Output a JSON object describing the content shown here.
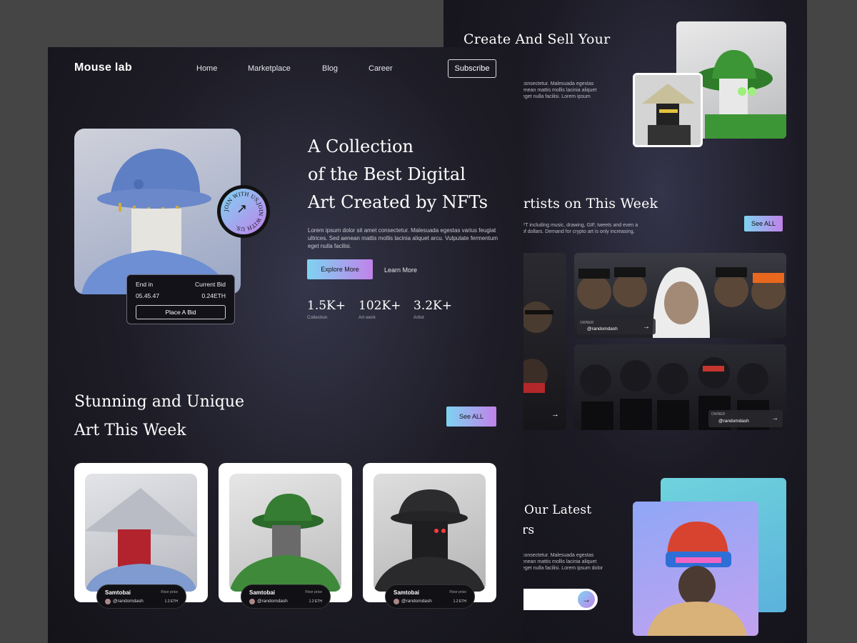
{
  "back": {
    "create_title": "Create And Sell Your",
    "create_desc": "consectetur. Malesuada egestas\nenean mattis mollis lacinia aliquet\neget nulla facilisi. Lorem ipsum",
    "artists_title": "rtists on This Week",
    "artists_desc": "FT including music, drawing, GIF, tweets and even a\nof dollars. Demand for crypto art is only increasing,",
    "see_all_label": "See ALL",
    "owner_label": "OWNER",
    "owner_name": "@randomdash",
    "latest_title_line1": "Our Latest",
    "latest_title_line2": "rs",
    "latest_desc": "consectetur. Malesuada egestas\nenean mattis mollis lacinia aliquet\neget nulla facilisi. Lorem ipsum dolor",
    "arrow_symbol": "→"
  },
  "front": {
    "logo": "Mouse lab",
    "nav": [
      "Home",
      "Marketplace",
      "Blog",
      "Career"
    ],
    "subscribe_label": "Subscribe",
    "hero_title": "A Collection\nof the Best Digital\nArt Created by NFTs",
    "hero_desc": "Lorem ipsum dolor sit amet consectetur. Malesuada egestas varius feugiat ultrices. Sed aenean mattis mollis lacinia aliquet arcu. Vulputate fermentum eget nulla facilisi.",
    "explore_label": "Explore More",
    "learn_label": "Learn More",
    "stats": [
      {
        "value": "1.5K+",
        "label": "Collection"
      },
      {
        "value": "102K+",
        "label": "Art work"
      },
      {
        "value": "3.2K+",
        "label": "Artist"
      }
    ],
    "bid": {
      "end_label": "End in",
      "current_label": "Current Bid",
      "time": "05.45.47",
      "price": "0.24ETH",
      "place_label": "Place A Bid"
    },
    "badge_text": "JOIN WITH US.JOIN WITH US.",
    "badge_arrow": "↗",
    "section_title": "Stunning and Unique\nArt This Week",
    "see_all_label": "See ALL",
    "cards": [
      {
        "name": "Samtobai",
        "floor_label": "Floor price",
        "user": "@randomdash",
        "price": "1.2 ETH"
      },
      {
        "name": "Samtobai",
        "floor_label": "Floor price",
        "user": "@randomdash",
        "price": "1.2 ETH"
      },
      {
        "name": "Samtobai",
        "floor_label": "Floor price",
        "user": "@randomdash",
        "price": "1.2 ETH"
      }
    ]
  },
  "colors": {
    "accent_start": "#7ed3f1",
    "accent_end": "#c182ea",
    "background": "#1c1b25"
  },
  "icons": {
    "arrow": "arrow-up-right-icon",
    "arrow_right": "arrow-right-icon"
  }
}
